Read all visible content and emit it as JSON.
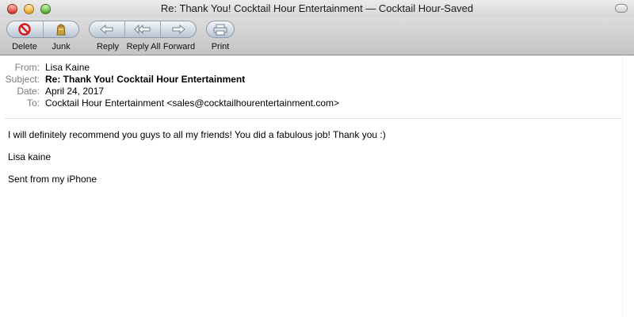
{
  "window": {
    "title": "Re: Thank You! Cocktail Hour Entertainment — Cocktail Hour-Saved"
  },
  "toolbar": {
    "delete_label": "Delete",
    "junk_label": "Junk",
    "reply_label": "Reply",
    "reply_all_label": "Reply All",
    "forward_label": "Forward",
    "print_label": "Print"
  },
  "headers": {
    "from_label": "From:",
    "from_value": "Lisa Kaine",
    "subject_label": "Subject:",
    "subject_value": "Re: Thank You! Cocktail Hour Entertainment",
    "date_label": "Date:",
    "date_value": "April 24, 2017",
    "to_label": "To:",
    "to_value": "Cocktail Hour Entertainment <sales@cocktailhourentertainment.com>"
  },
  "message": {
    "line1": "I will definitely recommend you guys to all my friends! You did a fabulous job! Thank you :)",
    "line2": "Lisa kaine",
    "line3": "Sent from my iPhone"
  },
  "icons": {
    "close": "close-light-icon",
    "minimize": "minimize-light-icon",
    "zoom": "zoom-light-icon",
    "delete": "no-entry-icon",
    "junk": "junk-bag-icon",
    "reply": "reply-arrow-icon",
    "reply_all": "reply-all-arrow-icon",
    "forward": "forward-arrow-icon",
    "print": "printer-icon"
  }
}
